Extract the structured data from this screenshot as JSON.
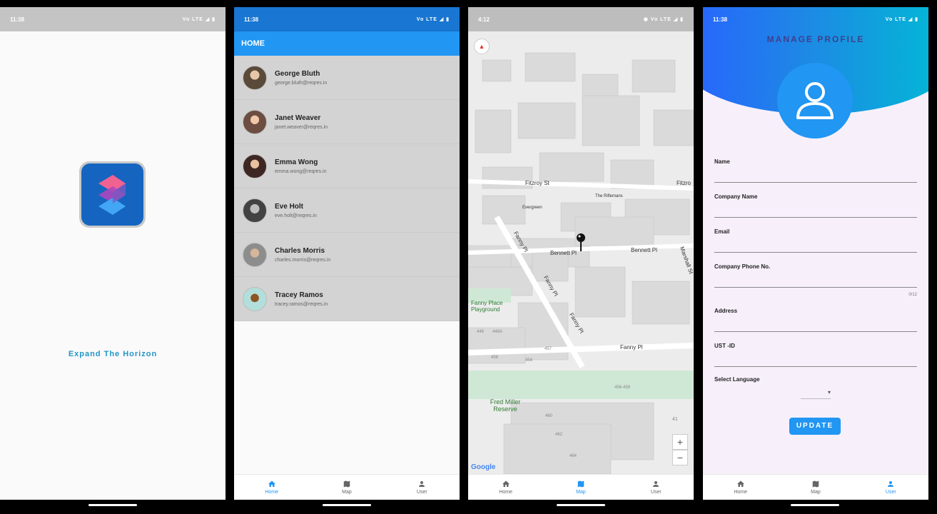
{
  "screens": {
    "splash": {
      "time": "11:38",
      "signal": "Vo LTE ◢ ▮",
      "tagline": "Expand The Horizon"
    },
    "home": {
      "time": "11:38",
      "signal": "Vo LTE ◢ ▮",
      "title": "HOME",
      "users": [
        {
          "name": "George Bluth",
          "email": "george.bluth@reqres.in"
        },
        {
          "name": "Janet Weaver",
          "email": "janet.weaver@reqres.in"
        },
        {
          "name": "Emma Wong",
          "email": "emma.wong@reqres.in"
        },
        {
          "name": "Eve Holt",
          "email": "eve.holt@reqres.in"
        },
        {
          "name": "Charles Morris",
          "email": "charles.morris@reqres.in"
        },
        {
          "name": "Tracey Ramos",
          "email": "tracey.ramos@reqres.in"
        }
      ]
    },
    "map": {
      "time": "4:12",
      "signal": "◉ Vo LTE ◢ ▮",
      "labels": {
        "fitzroy": "Fitzroy St",
        "fitzroy2": "Fitzro",
        "riflemans": "The Riflemans",
        "evergreen": "Evergreen",
        "bennett1": "Bennett Pl",
        "bennett2": "Bennett Pl",
        "fanny1": "Fanny Pl",
        "fanny2": "Fanny Pl",
        "fanny3": "Fanny Pl",
        "fanny4": "Fanny Pl",
        "playground": "Fanny Place Playground",
        "reserve": "Fred Miller Reserve",
        "marshall": "Marshall St",
        "num_456": "456-458",
        "num_460": "460",
        "num_462": "462",
        "num_464": "464",
        "num_448": "448",
        "num_448a": "448A",
        "num_458": "458",
        "num_454": "454",
        "num_457": "457",
        "num_41": "41"
      },
      "zoom_in": "+",
      "zoom_out": "−",
      "attribution": "Google"
    },
    "profile": {
      "time": "11:38",
      "signal": "Vo LTE ◢ ▮",
      "title": "MANAGE PROFILE",
      "fields": {
        "name": "Name",
        "company": "Company Name",
        "email": "Email",
        "phone": "Company Phone No.",
        "address": "Address",
        "ust": "UST -ID"
      },
      "phone_counter": "0/12",
      "language_label": "Select Language",
      "language_value": "▾",
      "update_label": "UPDATE"
    }
  },
  "nav": {
    "home": "Home",
    "map": "Map",
    "user": "User"
  },
  "colors": {
    "primary": "#2196f3",
    "tagline": "#2196c8",
    "title": "#3f3f8f"
  }
}
